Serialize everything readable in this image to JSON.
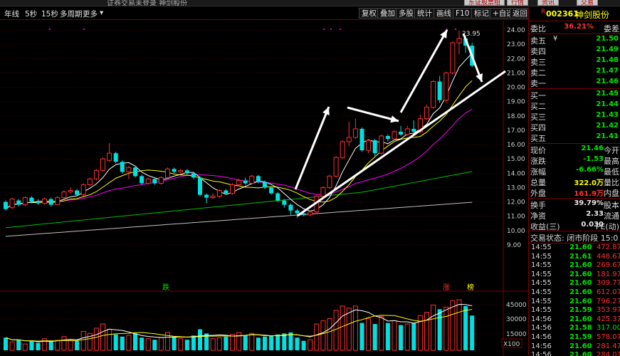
{
  "window": {
    "title": "证券交易未登录  神剑股份",
    "top_buttons": [
      "东证股票组",
      "行情",
      "资讯",
      "交易"
    ]
  },
  "toolbar": {
    "left": [
      "年线",
      "5秒",
      "15秒",
      "多周期",
      "更多",
      "▾"
    ],
    "right": [
      "复权",
      "叠加",
      "多股",
      "统计",
      "画线",
      "F10",
      "标记",
      "+自选",
      "返回"
    ]
  },
  "chart": {
    "y_ticks": [
      "24.00",
      "23.00",
      "22.00",
      "21.00",
      "20.00",
      "19.00",
      "18.00",
      "17.00",
      "16.00",
      "15.00",
      "14.00",
      "13.00",
      "12.00",
      "11.00",
      "10.00",
      "9.00"
    ],
    "peak_label": "23.95",
    "vol_ticks": [
      "45000",
      "30000",
      "15000"
    ],
    "vol_unit": "X100",
    "markers": {
      "down": "跌",
      "up": "涨",
      "limit": "榜"
    },
    "colors": {
      "up": "#ff3030",
      "down": "#00e0e0",
      "ma5": "#ffffff",
      "ma10": "#ffff00",
      "ma20": "#ff00ff",
      "ma60": "#00c000",
      "ma120": "#c0c0c0"
    }
  },
  "chart_data": {
    "type": "candlestick",
    "ylim": [
      9,
      24
    ],
    "candles": [
      [
        12.0,
        11.5,
        12.1,
        11.4
      ],
      [
        11.6,
        12.2,
        12.3,
        11.5
      ],
      [
        12.1,
        11.8,
        12.2,
        11.7
      ],
      [
        11.8,
        12.3,
        12.4,
        11.7
      ],
      [
        12.3,
        12.0,
        12.4,
        11.9
      ],
      [
        12.0,
        11.9,
        12.2,
        11.8
      ],
      [
        11.9,
        12.2,
        12.3,
        11.8
      ],
      [
        12.2,
        11.8,
        12.3,
        11.7
      ],
      [
        11.8,
        12.3,
        12.4,
        11.8
      ],
      [
        12.3,
        12.7,
        12.8,
        12.2
      ],
      [
        12.7,
        12.8,
        13.0,
        12.6
      ],
      [
        12.8,
        12.5,
        12.9,
        12.4
      ],
      [
        12.5,
        13.2,
        13.3,
        12.4
      ],
      [
        13.2,
        13.6,
        13.7,
        13.1
      ],
      [
        13.6,
        14.2,
        14.3,
        13.5
      ],
      [
        14.2,
        15.0,
        15.1,
        14.1
      ],
      [
        14.9,
        15.4,
        16.1,
        14.8
      ],
      [
        15.4,
        14.8,
        15.5,
        14.7
      ],
      [
        14.8,
        14.1,
        14.9,
        14.0
      ],
      [
        14.1,
        14.4,
        14.5,
        13.6
      ],
      [
        14.4,
        13.8,
        14.5,
        13.7
      ],
      [
        13.8,
        13.3,
        13.9,
        13.2
      ],
      [
        13.3,
        13.6,
        13.7,
        13.2
      ],
      [
        13.6,
        13.3,
        13.7,
        13.2
      ],
      [
        13.3,
        13.7,
        13.8,
        13.2
      ],
      [
        13.7,
        14.3,
        14.4,
        13.6
      ],
      [
        14.3,
        14.1,
        14.4,
        14.0
      ],
      [
        14.1,
        14.2,
        14.3,
        14.0
      ],
      [
        14.2,
        14.0,
        14.3,
        13.9
      ],
      [
        14.0,
        13.7,
        14.1,
        13.6
      ],
      [
        13.7,
        12.5,
        13.8,
        12.4
      ],
      [
        12.5,
        12.3,
        12.6,
        11.9
      ],
      [
        12.3,
        12.4,
        12.6,
        12.2
      ],
      [
        12.4,
        12.8,
        12.9,
        12.3
      ],
      [
        12.8,
        12.6,
        12.9,
        12.5
      ],
      [
        12.6,
        13.2,
        13.3,
        12.5
      ],
      [
        13.2,
        13.5,
        13.6,
        13.1
      ],
      [
        13.5,
        13.3,
        13.7,
        13.2
      ],
      [
        13.3,
        13.8,
        13.9,
        13.2
      ],
      [
        13.8,
        13.4,
        13.9,
        13.3
      ],
      [
        13.4,
        13.0,
        13.5,
        12.9
      ],
      [
        13.0,
        12.6,
        13.1,
        12.5
      ],
      [
        12.6,
        12.1,
        12.7,
        12.0
      ],
      [
        12.1,
        11.8,
        12.2,
        11.6
      ],
      [
        11.8,
        11.4,
        11.9,
        11.1
      ],
      [
        11.4,
        11.2,
        11.5,
        10.9
      ],
      [
        11.2,
        11.1,
        11.3,
        11.0
      ],
      [
        11.1,
        11.3,
        11.4,
        11.0
      ],
      [
        11.3,
        12.4,
        12.5,
        11.2
      ],
      [
        12.4,
        13.0,
        13.1,
        12.3
      ],
      [
        13.0,
        13.8,
        13.9,
        12.9
      ],
      [
        13.8,
        15.1,
        15.2,
        13.7
      ],
      [
        15.1,
        16.2,
        16.3,
        15.0
      ],
      [
        16.2,
        16.5,
        17.6,
        15.9
      ],
      [
        16.5,
        17.1,
        17.8,
        16.4
      ],
      [
        17.1,
        15.6,
        17.2,
        15.5
      ],
      [
        15.6,
        16.3,
        16.4,
        15.4
      ],
      [
        16.3,
        15.4,
        16.4,
        15.2
      ],
      [
        15.4,
        16.6,
        16.7,
        15.3
      ],
      [
        16.6,
        16.4,
        16.7,
        16.2
      ],
      [
        16.4,
        16.9,
        17.0,
        16.3
      ],
      [
        16.9,
        16.7,
        17.3,
        16.6
      ],
      [
        16.7,
        17.1,
        17.3,
        16.6
      ],
      [
        17.1,
        16.9,
        17.7,
        16.8
      ],
      [
        16.9,
        17.8,
        18.1,
        16.8
      ],
      [
        17.8,
        18.6,
        18.8,
        17.7
      ],
      [
        18.6,
        20.4,
        20.5,
        18.5
      ],
      [
        20.4,
        19.1,
        20.8,
        18.9
      ],
      [
        19.1,
        21.0,
        21.1,
        18.9
      ],
      [
        21.0,
        23.1,
        23.2,
        20.9
      ],
      [
        23.1,
        23.4,
        23.95,
        22.3
      ],
      [
        23.4,
        22.9,
        23.6,
        22.4
      ],
      [
        22.9,
        21.5,
        23.1,
        21.4
      ]
    ],
    "volume": [
      120,
      80,
      100,
      60,
      90,
      70,
      110,
      85,
      95,
      130,
      100,
      90,
      180,
      160,
      210,
      250,
      200,
      150,
      130,
      140,
      160,
      120,
      110,
      100,
      120,
      170,
      130,
      110,
      100,
      140,
      200,
      160,
      110,
      120,
      130,
      150,
      170,
      140,
      160,
      120,
      130,
      140,
      150,
      160,
      170,
      120,
      90,
      100,
      250,
      280,
      300,
      380,
      420,
      400,
      420,
      260,
      300,
      250,
      320,
      260,
      280,
      240,
      250,
      260,
      330,
      360,
      430,
      390,
      410,
      470,
      480,
      420,
      330
    ],
    "volume_max": 50000
  },
  "panel": {
    "r_mark": "R",
    "code": "002361",
    "name": "神剑股份",
    "weibi": {
      "label": "委比",
      "value": "36.21%",
      "label2": "委差"
    },
    "sells": [
      {
        "label": "卖五",
        "mark": "¥",
        "price": "21.50"
      },
      {
        "label": "卖四",
        "price": "21.49"
      },
      {
        "label": "卖三",
        "price": "21.48"
      },
      {
        "label": "卖二",
        "price": "21.47"
      },
      {
        "label": "卖一",
        "price": "21.46"
      }
    ],
    "buys": [
      {
        "label": "买一",
        "price": "21.45"
      },
      {
        "label": "买二",
        "price": "21.44"
      },
      {
        "label": "买三",
        "price": "21.43"
      },
      {
        "label": "买四",
        "price": "21.42"
      },
      {
        "label": "买五",
        "price": "21.41"
      }
    ],
    "stats": [
      {
        "label": "现价",
        "value": "21.46",
        "label2": "今开",
        "color": "green"
      },
      {
        "label": "涨跌",
        "value": "-1.53",
        "label2": "最高",
        "color": "green"
      },
      {
        "label": "涨幅",
        "value": "-6.66%",
        "label2": "最低",
        "color": "green"
      },
      {
        "label": "总量",
        "value": "322.0万",
        "label2": "量比",
        "color": "yellow"
      },
      {
        "label": "外盘",
        "value": "161.9万",
        "label2": "内盘",
        "color": "red"
      }
    ],
    "stats2": [
      {
        "label": "换手",
        "value": "39.79%",
        "label2": "股本",
        "color": "white"
      },
      {
        "label": "净资",
        "value": "2.33",
        "label2": "流通",
        "color": "white"
      },
      {
        "label": "收益(三)",
        "value": "0.030",
        "label2": "PE(动)",
        "color": "white"
      }
    ],
    "status": "交易状态: 闭市阶段 15:0",
    "trades": [
      {
        "t": "14:55",
        "p": "21.60",
        "q": "472.87",
        "qc": "red"
      },
      {
        "t": "14:55",
        "p": "21.61",
        "q": "448.67",
        "qc": "red"
      },
      {
        "t": "14:55",
        "p": "21.60",
        "q": "269.67",
        "qc": "red"
      },
      {
        "t": "14:55",
        "p": "21.60",
        "q": "181.97",
        "qc": "red"
      },
      {
        "t": "14:55",
        "p": "21.60",
        "q": "309.77",
        "qc": "red"
      },
      {
        "t": "14:55",
        "p": "21.60",
        "q": "612.07",
        "qc": "red"
      },
      {
        "t": "14:55",
        "p": "21.60",
        "q": "796.27",
        "qc": "red"
      },
      {
        "t": "14:55",
        "p": "21.59",
        "q": "353.97",
        "qc": "red"
      },
      {
        "t": "14:56",
        "p": "21.60",
        "q": "425.37",
        "qc": "red"
      },
      {
        "t": "14:56",
        "p": "21.58",
        "q": "317.00",
        "qc": "green"
      },
      {
        "t": "14:56",
        "p": "21.59",
        "q": "578.07",
        "qc": "red"
      },
      {
        "t": "14:56",
        "p": "21.60",
        "q": "281.47",
        "qc": "red"
      },
      {
        "t": "14:56",
        "p": "21.60",
        "q": "284.07",
        "qc": "red"
      }
    ]
  }
}
